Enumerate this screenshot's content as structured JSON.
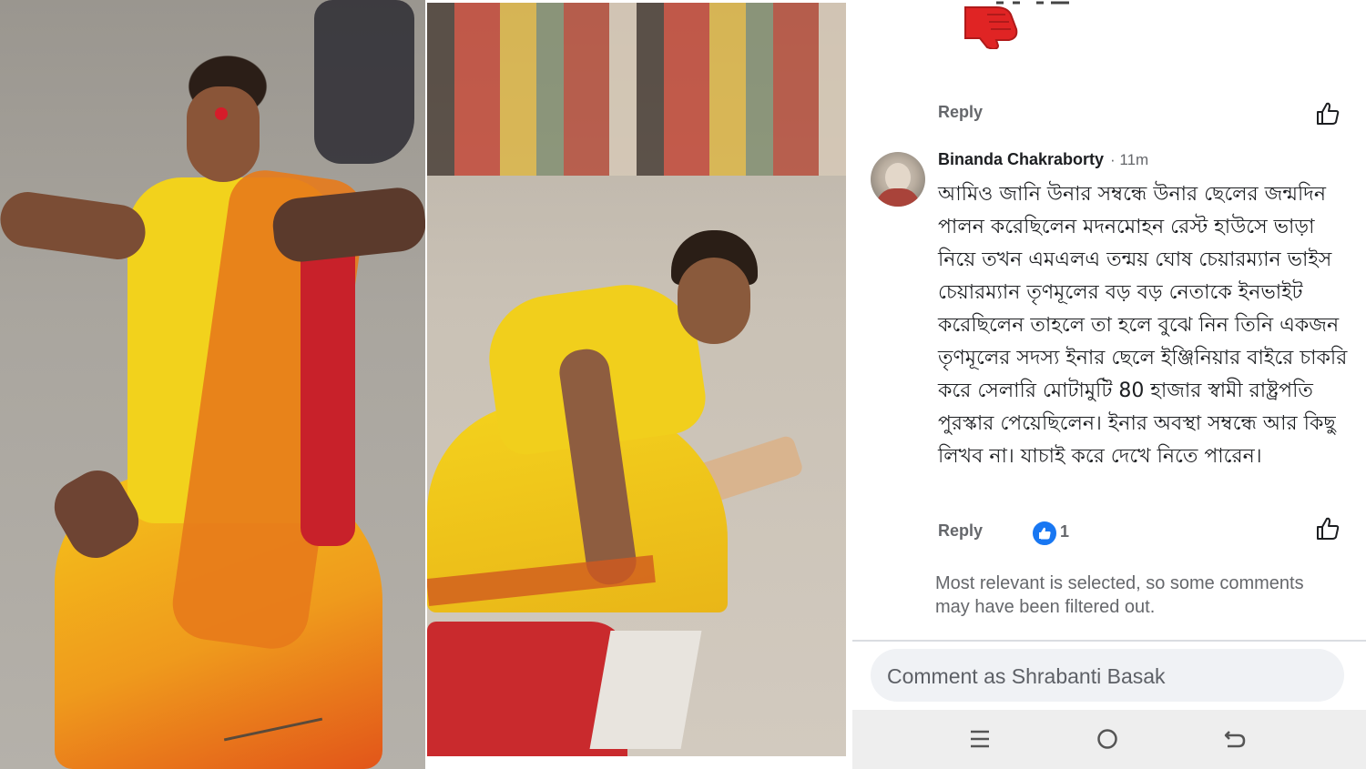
{
  "photos": {
    "left_alt": "woman in yellow saree sitting on road with arms outstretched",
    "middle_alt": "newspaper photo of woman in yellow saree crying on ground"
  },
  "comments": [
    {
      "reply_label": "Reply"
    },
    {
      "author": "Binanda Chakraborty",
      "time": "· 11m",
      "text": "আমিও জানি উনার সম্বন্ধে উনার ছেলের জন্মদিন পালন করেছিলেন মদনমোহন রেস্ট হাউসে ভাড়া নিয়ে তখন এমএলএ তন্ময় ঘোষ চেয়ারম্যান ভাইস চেয়ারম্যান তৃণমূলের বড় বড় নেতাকে ইনভাইট করেছিলেন তাহলে তা হলে বুঝে নিন তিনি একজন তৃণমূলের সদস্য ইনার ছেলে ইঞ্জিনিয়ার বাইরে চাকরি করে সেলারি মোটামুটি 80 হাজার স্বামী রাষ্ট্রপতি পুরস্কার পেয়েছিলেন। ইনার অবস্থা সম্বন্ধে আর কিছু লিখব না। যাচাই করে দেখে নিতে পারেন।",
      "reply_label": "Reply",
      "reaction_count": "1"
    }
  ],
  "notice": "Most relevant is selected, so some comments may have been filtered out.",
  "composer": {
    "placeholder": "Comment as Shrabanti Basak"
  },
  "icons": {
    "like": "thumbs-up-icon",
    "reaction": "like-reaction-icon",
    "nav_recent": "recent-apps-icon",
    "nav_home": "home-icon",
    "nav_back": "back-icon"
  },
  "colors": {
    "facebook_blue": "#1877f2",
    "secondary_text": "#65676b",
    "composer_bg": "#f0f2f5"
  }
}
